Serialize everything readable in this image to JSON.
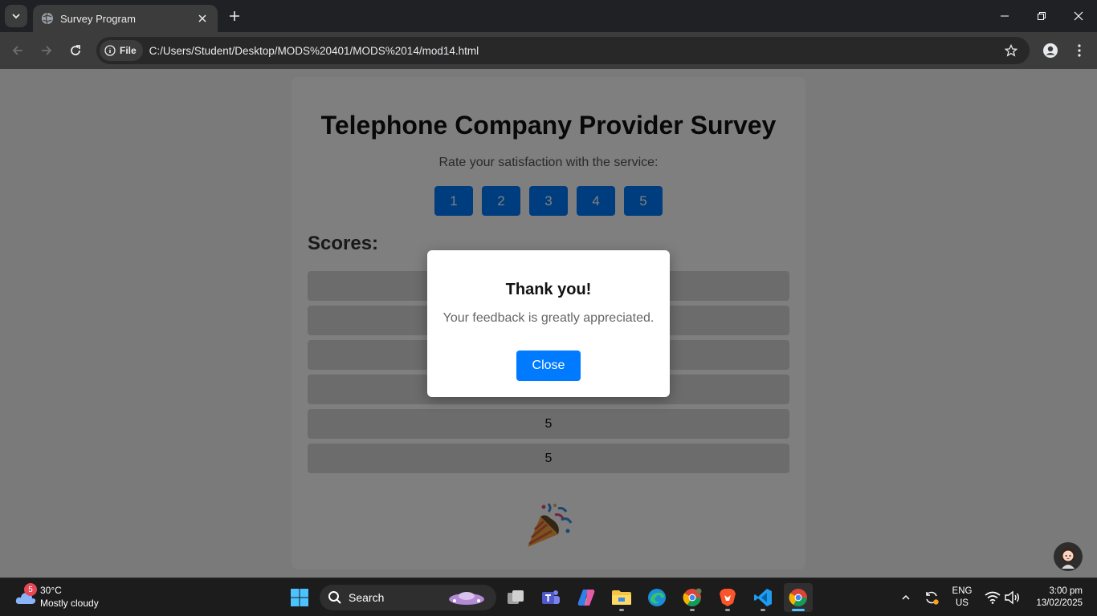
{
  "browser": {
    "tab_title": "Survey Program",
    "address_chip": "File",
    "url": "C:/Users/Student/Desktop/MODS%20401/MODS%2014/mod14.html"
  },
  "page": {
    "title": "Telephone Company Provider Survey",
    "prompt": "Rate your satisfaction with the service:",
    "rating_buttons": [
      "1",
      "2",
      "3",
      "4",
      "5"
    ],
    "scores_heading": "Scores:",
    "scores": [
      "",
      "",
      "",
      "",
      "5",
      "5"
    ]
  },
  "modal": {
    "title": "Thank you!",
    "message": "Your feedback is greatly appreciated.",
    "close_label": "Close"
  },
  "taskbar": {
    "weather_badge": "5",
    "weather_temp": "30°C",
    "weather_desc": "Mostly cloudy",
    "search_label": "Search",
    "lang_line1": "ENG",
    "lang_line2": "US",
    "time": "3:00 pm",
    "date": "13/02/2025"
  },
  "colors": {
    "accent": "#007bff",
    "overlay": "rgba(0,0,0,0.5)",
    "browser_dark": "#202124"
  }
}
